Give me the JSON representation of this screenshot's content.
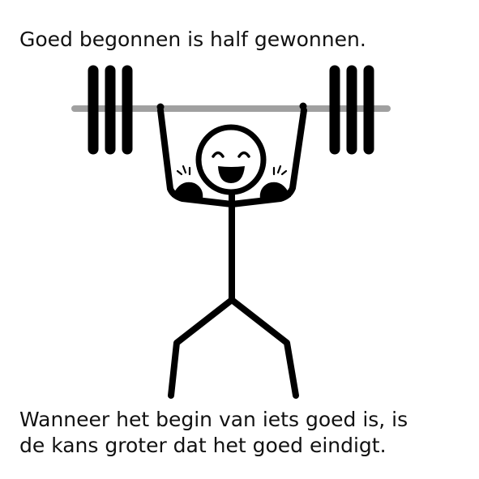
{
  "top_caption": "Goed begonnen is half gewonnen.",
  "bottom_caption": {
    "line1": "Wanneer het begin van iets goed is, is",
    "line2": "de kans groter dat het goed eindigt."
  },
  "illustration": {
    "icon": "weightlifter-stick-figure-icon",
    "colors": {
      "ink": "#000000",
      "bar": "#a0a0a0"
    }
  }
}
